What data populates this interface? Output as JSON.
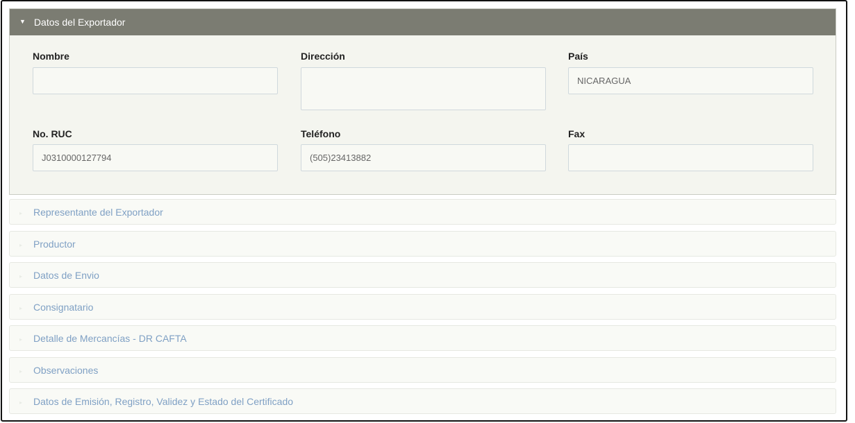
{
  "exportador": {
    "title": "Datos del Exportador",
    "fields": {
      "nombre": {
        "label": "Nombre",
        "value": ""
      },
      "direccion": {
        "label": "Dirección",
        "value": ""
      },
      "pais": {
        "label": "País",
        "value": "NICARAGUA"
      },
      "ruc": {
        "label": "No. RUC",
        "value": "J0310000127794"
      },
      "telefono": {
        "label": "Teléfono",
        "value": "(505)23413882"
      },
      "fax": {
        "label": "Fax",
        "value": ""
      }
    }
  },
  "sections": [
    {
      "label": "Representante del Exportador"
    },
    {
      "label": "Productor"
    },
    {
      "label": "Datos de Envio"
    },
    {
      "label": "Consignatario"
    },
    {
      "label": "Detalle de Mercancías - DR CAFTA"
    },
    {
      "label": "Observaciones"
    },
    {
      "label": "Datos de Emisión, Registro, Validez y Estado del Certificado"
    }
  ],
  "colors": {
    "header_bg": "#7b7c72",
    "panel_bg": "#f4f5ef",
    "section_link": "#7fa0c4"
  }
}
